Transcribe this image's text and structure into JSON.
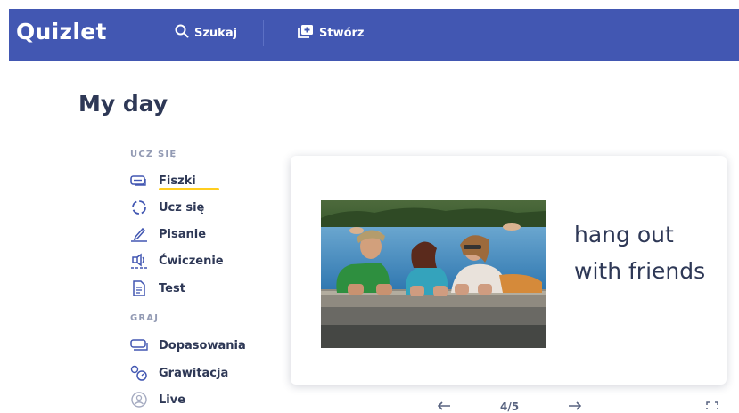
{
  "app": {
    "logo": "Quizlet",
    "brand_color": "#4257b2"
  },
  "nav": {
    "search_label": "Szukaj",
    "create_label": "Stwórz"
  },
  "page_title": "My day",
  "sidebar": {
    "study_section": "UCZ SIĘ",
    "study_items": [
      {
        "label": "Fiszki",
        "icon": "flashcards-icon",
        "active": true
      },
      {
        "label": "Ucz się",
        "icon": "learn-icon"
      },
      {
        "label": "Pisanie",
        "icon": "write-icon"
      },
      {
        "label": "Ćwiczenie",
        "icon": "spell-icon"
      },
      {
        "label": "Test",
        "icon": "test-icon"
      }
    ],
    "play_section": "GRAJ",
    "play_items": [
      {
        "label": "Dopasowania",
        "icon": "match-icon"
      },
      {
        "label": "Grawitacja",
        "icon": "gravity-icon"
      },
      {
        "label": "Live",
        "icon": "live-icon"
      }
    ]
  },
  "flashcard": {
    "term": "hang out with friends",
    "image_icon": "friends-on-pier-photo"
  },
  "controls": {
    "progress": "4/5",
    "prev_icon": "arrow-left-icon",
    "next_icon": "arrow-right-icon",
    "fullscreen_icon": "fullscreen-icon"
  }
}
